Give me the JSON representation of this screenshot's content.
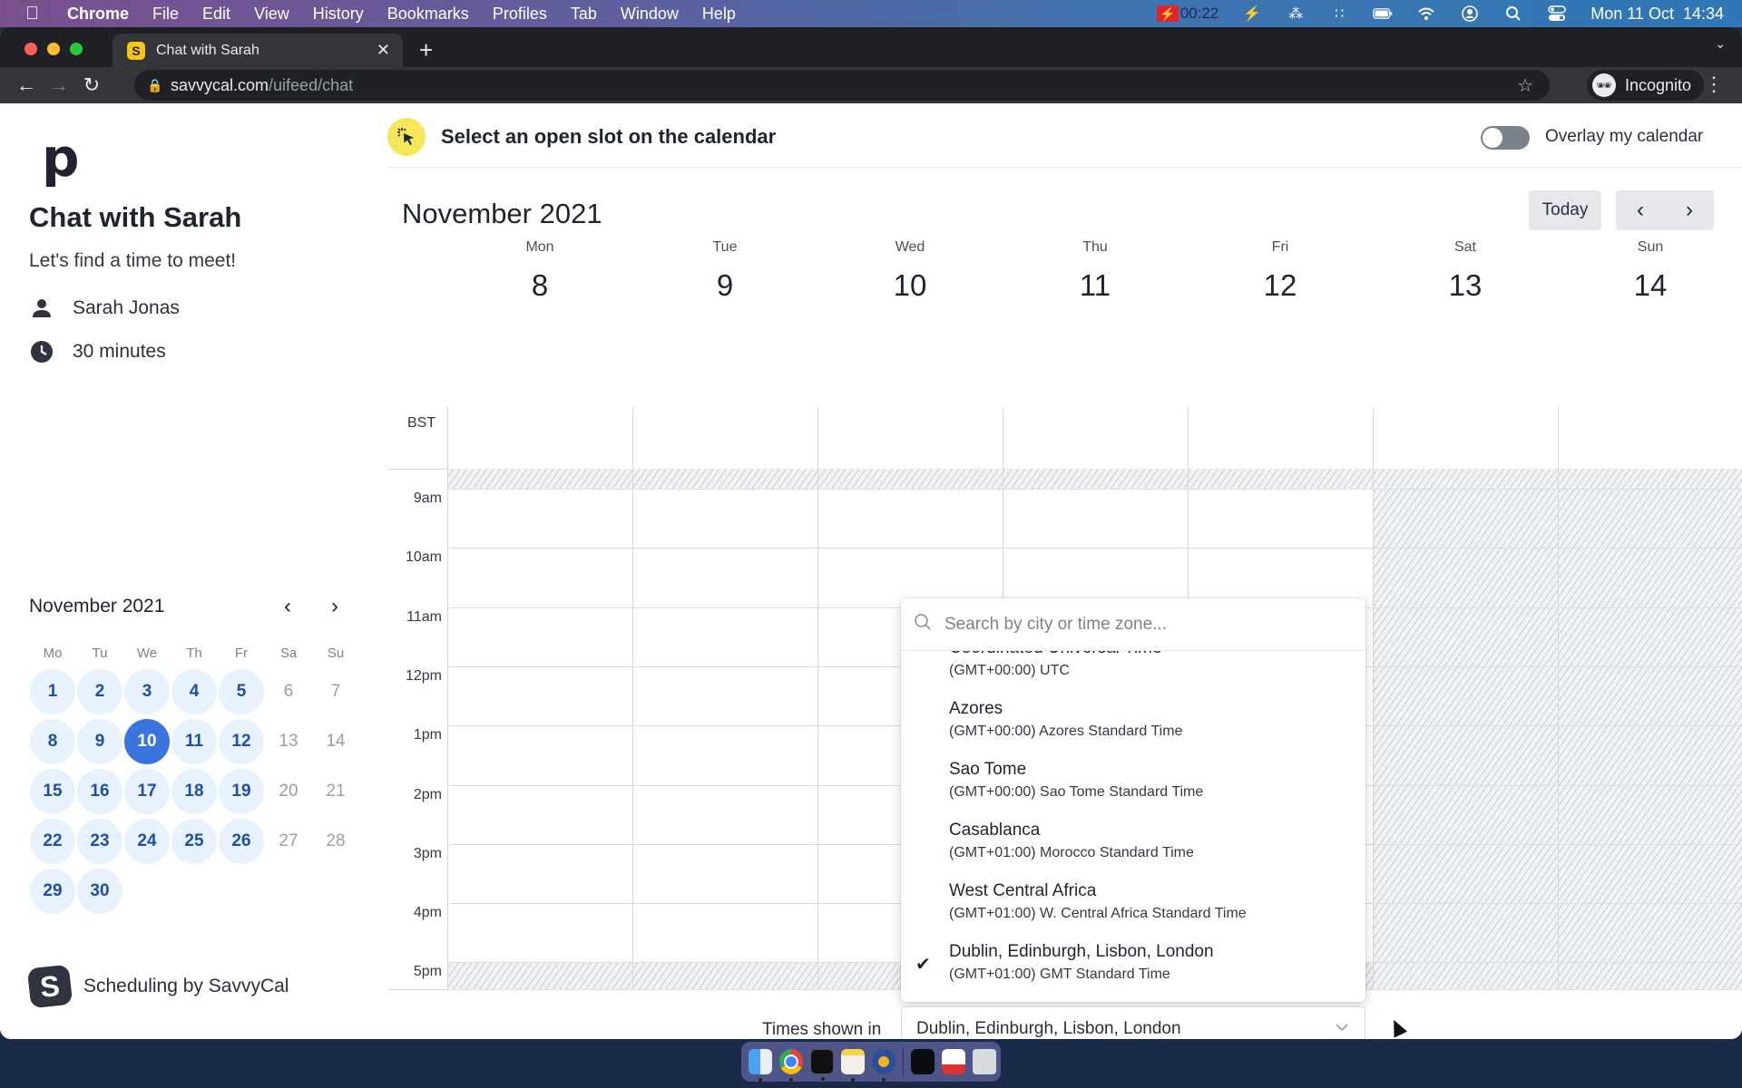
{
  "menubar": {
    "app_name": "Chrome",
    "items": [
      "File",
      "Edit",
      "View",
      "History",
      "Bookmarks",
      "Profiles",
      "Tab",
      "Window",
      "Help"
    ],
    "recording_time": "00:22",
    "clock": "Mon 11 Oct  14:34",
    "status_icons": [
      "flash-icon",
      "bluetooth-off-icon",
      "dots-icon",
      "battery-charging-icon",
      "wifi-icon",
      "user-icon",
      "spotlight-search-icon",
      "control-center-icon"
    ]
  },
  "browser": {
    "tab_title": "Chat with Sarah",
    "tab_favicon": "S",
    "url_host": "savvycal.com",
    "url_path": "/uifeed/chat",
    "profile_label": "Incognito"
  },
  "sidebar": {
    "logo": "p",
    "title": "Chat with Sarah",
    "subtitle": "Let's find a time to meet!",
    "host_name": "Sarah Jonas",
    "duration": "30 minutes",
    "mini_calendar": {
      "month_label": "November 2021",
      "weekdays": [
        "Mo",
        "Tu",
        "We",
        "Th",
        "Fr",
        "Sa",
        "Su"
      ],
      "weeks": [
        [
          {
            "d": "1",
            "s": "avail"
          },
          {
            "d": "2",
            "s": "avail"
          },
          {
            "d": "3",
            "s": "avail"
          },
          {
            "d": "4",
            "s": "avail"
          },
          {
            "d": "5",
            "s": "avail"
          },
          {
            "d": "6",
            "s": "unavail"
          },
          {
            "d": "7",
            "s": "unavail"
          }
        ],
        [
          {
            "d": "8",
            "s": "avail"
          },
          {
            "d": "9",
            "s": "avail"
          },
          {
            "d": "10",
            "s": "selected"
          },
          {
            "d": "11",
            "s": "avail"
          },
          {
            "d": "12",
            "s": "avail"
          },
          {
            "d": "13",
            "s": "unavail"
          },
          {
            "d": "14",
            "s": "unavail"
          }
        ],
        [
          {
            "d": "15",
            "s": "avail"
          },
          {
            "d": "16",
            "s": "avail"
          },
          {
            "d": "17",
            "s": "avail"
          },
          {
            "d": "18",
            "s": "avail"
          },
          {
            "d": "19",
            "s": "avail"
          },
          {
            "d": "20",
            "s": "unavail"
          },
          {
            "d": "21",
            "s": "unavail"
          }
        ],
        [
          {
            "d": "22",
            "s": "avail"
          },
          {
            "d": "23",
            "s": "avail"
          },
          {
            "d": "24",
            "s": "avail"
          },
          {
            "d": "25",
            "s": "avail"
          },
          {
            "d": "26",
            "s": "avail"
          },
          {
            "d": "27",
            "s": "unavail"
          },
          {
            "d": "28",
            "s": "unavail"
          }
        ],
        [
          {
            "d": "29",
            "s": "avail"
          },
          {
            "d": "30",
            "s": "avail"
          },
          {
            "d": "",
            "s": "empty"
          },
          {
            "d": "",
            "s": "empty"
          },
          {
            "d": "",
            "s": "empty"
          },
          {
            "d": "",
            "s": "empty"
          },
          {
            "d": "",
            "s": "empty"
          }
        ]
      ]
    },
    "powered_by": "Scheduling by SavvyCal"
  },
  "main": {
    "prompt": "Select an open slot on the calendar",
    "overlay_label": "Overlay my calendar",
    "overlay_enabled": false,
    "month_title": "November 2021",
    "today_label": "Today",
    "days": [
      {
        "dow": "Mon",
        "num": "8",
        "weekend": false
      },
      {
        "dow": "Tue",
        "num": "9",
        "weekend": false
      },
      {
        "dow": "Wed",
        "num": "10",
        "weekend": false
      },
      {
        "dow": "Thu",
        "num": "11",
        "weekend": false
      },
      {
        "dow": "Fri",
        "num": "12",
        "weekend": false
      },
      {
        "dow": "Sat",
        "num": "13",
        "weekend": true
      },
      {
        "dow": "Sun",
        "num": "14",
        "weekend": true
      }
    ],
    "timezone_abbr": "BST",
    "hours": [
      "9am",
      "10am",
      "11am",
      "12pm",
      "1pm",
      "2pm",
      "3pm",
      "4pm",
      "5pm"
    ]
  },
  "timezone_picker": {
    "search_placeholder": "Search by city or time zone...",
    "search_value": "",
    "options": [
      {
        "name": "Coordinated Universal Time",
        "desc": "(GMT+00:00) UTC",
        "selected": false
      },
      {
        "name": "Azores",
        "desc": "(GMT+00:00) Azores Standard Time",
        "selected": false
      },
      {
        "name": "Sao Tome",
        "desc": "(GMT+00:00) Sao Tome Standard Time",
        "selected": false
      },
      {
        "name": "Casablanca",
        "desc": "(GMT+01:00) Morocco Standard Time",
        "selected": false
      },
      {
        "name": "West Central Africa",
        "desc": "(GMT+01:00) W. Central Africa Standard Time",
        "selected": false
      },
      {
        "name": "Dublin, Edinburgh, Lisbon, London",
        "desc": "(GMT+01:00) GMT Standard Time",
        "selected": true
      }
    ],
    "label": "Times shown in",
    "selected_value": "Dublin, Edinburgh, Lisbon, London"
  },
  "dock": {
    "apps": [
      "Finder",
      "Chrome",
      "Terminal",
      "Notes",
      "Reeder",
      "Screenshot",
      "Preview",
      "Trash"
    ]
  }
}
